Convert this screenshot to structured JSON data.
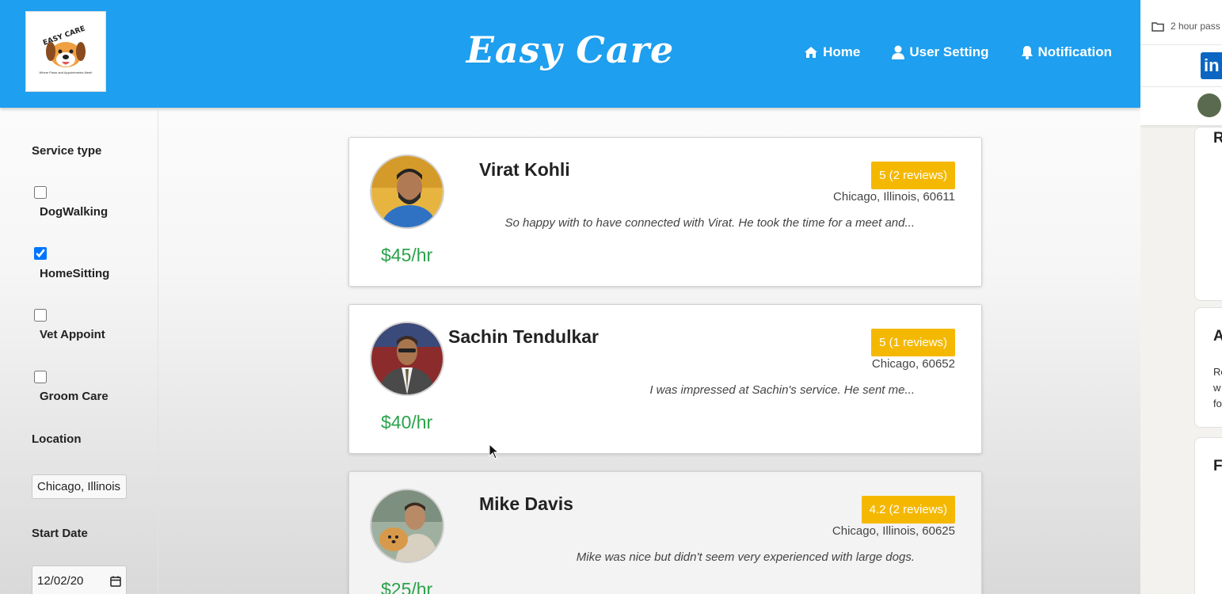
{
  "header": {
    "brand": "Easy Care",
    "logo_text": "EASY CARE",
    "logo_tagline": "Where Paws and Appointments Meet!",
    "nav": [
      {
        "label": "Home",
        "icon": "home-icon"
      },
      {
        "label": "User Setting",
        "icon": "user-icon"
      },
      {
        "label": "Notification",
        "icon": "bell-icon"
      }
    ]
  },
  "sidebar": {
    "service_type_heading": "Service type",
    "services": [
      {
        "label": "DogWalking",
        "checked": false
      },
      {
        "label": "HomeSitting",
        "checked": true
      },
      {
        "label": "Vet Appoint",
        "checked": false
      },
      {
        "label": "Groom Care",
        "checked": false
      }
    ],
    "location_heading": "Location",
    "location_value": "Chicago, Illinois",
    "start_date_heading": "Start Date",
    "start_date_value": "12/02/20"
  },
  "caregivers": [
    {
      "name": "Virat Kohli",
      "rating": "5 (2 reviews)",
      "location": "Chicago, Illinois, 60611",
      "review": "So happy with to have connected with Virat. He took the time for a meet and...",
      "price": "$45/hr"
    },
    {
      "name": "Sachin Tendulkar",
      "rating": "5 (1 reviews)",
      "location": "Chicago, 60652",
      "review": "I was impressed at Sachin's service. He sent me...",
      "price": "$40/hr"
    },
    {
      "name": "Mike Davis",
      "rating": "4.2 (2 reviews)",
      "location": "Chicago, Illinois, 60625",
      "review": "Mike was nice but didn't seem very experienced with large dogs.",
      "price": "$25/hr"
    }
  ],
  "right_panel": {
    "bookmark": "2 hour pass",
    "brand_letters": "in",
    "letters": [
      "R",
      "A",
      "F"
    ],
    "snippet_lines": [
      "Re",
      "w",
      "fo"
    ]
  },
  "colors": {
    "header_bg": "#1e9fef",
    "rating_bg": "#f5b800",
    "price": "#2aa34a"
  }
}
